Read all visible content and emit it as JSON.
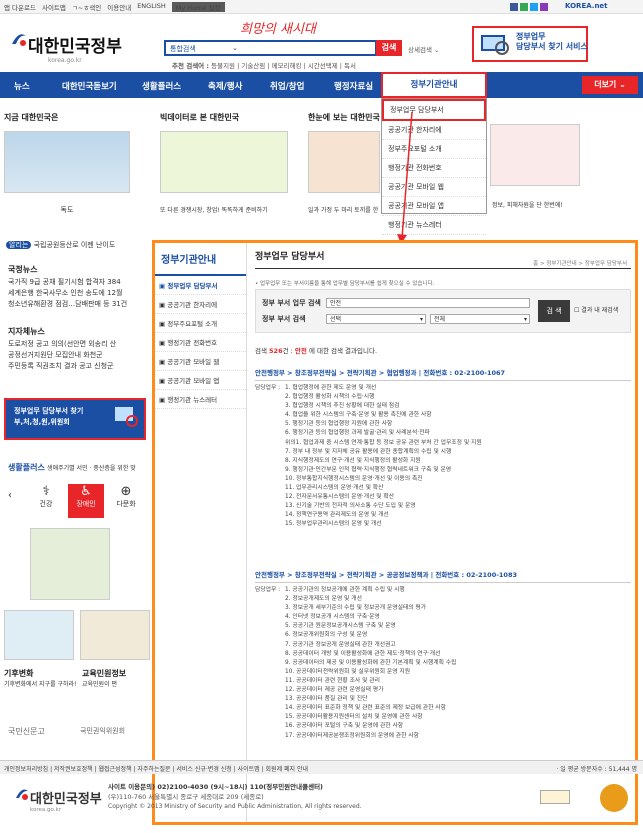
{
  "topbar": {
    "links": [
      "앱 다운로드",
      "사이트맵",
      "ㄱ~ㅎ색인",
      "이용안내",
      "ENGLISH"
    ],
    "my_home": "My Home 설정",
    "right_logo": "KOREA.net"
  },
  "header": {
    "logo_text": "대한민국정부",
    "logo_sub": "korea.go.kr",
    "search_value": "통합검색",
    "search_button": "검색",
    "detail_search": "상세검색",
    "recommended_label": "추천 검색어 :",
    "recommended": "등불지원 | 기술산림 | 메모리해킹 | 시간선택제 | 독서",
    "service_box": "정부업무\n담당부서 찾기 서비스",
    "service_l1": "정부업무",
    "service_l2": "담당부서 찾기 서비스"
  },
  "nav": {
    "items": [
      "뉴스",
      "대한민국돋보기",
      "생활플러스",
      "축제/행사",
      "취업/창업",
      "행정자료실"
    ],
    "active": "정부기관안내",
    "more": "더보기"
  },
  "dropdown": {
    "items": [
      "정부업무 담당부서",
      "공공기관 한자리에",
      "정부주요포털 소개",
      "행정기관 전화번호",
      "공공기관 모바일 웹",
      "공공기관 모바일 앱",
      "행정기관 뉴스레터"
    ]
  },
  "left": {
    "sec1_title": "지금 대한민국은",
    "sec1_caption": "독도",
    "sec2_title": "빅데이터로 본 대한민국",
    "sec2_caption": "또 다른 경쟁시장, 창업! 똑똑하게 준비하기",
    "sec3_title": "한눈에 보는 대한민국",
    "sec3_caption": "일과 가정 두 마리 토끼를 한",
    "sec4_caption": "정보, 피해자원을 단 한번에!",
    "notice_tag": "알리는",
    "notice_text": "국립공원등산로 이젠 난이도",
    "gov_news_title": "국정뉴스",
    "gov_news": [
      "국가직 9급 공채 필기시험 합격자 384",
      "세계은행 한국사무소 인천 송도에 12월",
      "청소년유해환경 점검…담배판매 등 31건"
    ],
    "local_news_title": "지자체뉴스",
    "local_news": [
      "도로저정 공고 의의(선안면 외송리 산",
      "공정선거지원단 모집안내 화천군",
      "주민등록 직권조치 결과 공고 신청군"
    ],
    "banner_text": "정부업무 담당부서 찾기\n부,처,청,원,위원회",
    "banner_l1": "정부업무 담당부서 찾기",
    "banner_l2": "부,처,청,원,위원회",
    "life_title": "생활플러스",
    "life_sub": "생애주기별 서민 · 중산층을 위한 맞",
    "life_icons": [
      "건강",
      "장애인",
      "다문화"
    ],
    "welfare_title": "기후변화",
    "welfare_text": "기후변화에서 지구를 구하라!",
    "edu_title": "교육민원정보",
    "edu_text": "교육민원이 편",
    "logos": [
      "국민신문고",
      "국민권익위원회"
    ]
  },
  "overlay": {
    "side_title": "정부기관안내",
    "side_items": [
      "정부업무 담당부서",
      "공공기관 한자리에",
      "정부주요포털 소개",
      "행정기관 전화번호",
      "공공기관 모바일 웹",
      "공공기관 모바일 앱",
      "행정기관 뉴스레터"
    ],
    "title": "정부업무 담당부서",
    "crumb": "홈 > 정부기관안내 > 정부업무 담당부서",
    "intro": "• 업무업무 또는 부서이름을 통해 업무별 담당부서를 쉽게 찾으실 수 있습니다.",
    "label_duty": "정부 부서 업무 검색",
    "duty_value": "안전",
    "label_dept": "정부 부서 검색",
    "dept_select": "선택",
    "dept_select2": "전체",
    "search_btn": "검 색",
    "in_result": "결과 내 재검색",
    "result_prefix": "검색 ",
    "result_count": "526",
    "result_mid": "건 : ",
    "result_kw": "안전",
    "result_suffix": " 에 대한 검색 결과입니다.",
    "dept1": "안전행정부 > 창조정부전략실 > 전략기획관 > 협업행정과  |  전화번호 : 02-2100-1067",
    "dept1_label": "담당업무 :",
    "duties1": [
      "1. 협업행정에 관한 제도 운영 및 개선",
      "2. 협업행정 활성화 시책의 수립·시행",
      "3. 협업행정 시책의 추진 상황에 대한 실태 점검",
      "4. 협업을 위한 시스템의 구축·운영 및 활용 촉진에 관한 사항",
      "5. 행정기관 등의 협업행정 지원에 관한 사항",
      "6. 행정기관 등의 협업행정 과제 발굴·관리 및 사례분석·전파",
      "위의1. 협업과제 중 시스템 연계·통합 등 정보 공유 관련 부처 간 업무조정 및 지원",
      "7. 정부 내 정부 및 지자체 공유 활용에 관한 종합계획의 수립 및 시행",
      "8. 지식행정제도의 연구·개선 및 지식행정의 활성화 지원",
      "9. 행정기관·민간부문 인적 협력·지식행정 협력네트워크 구축 및 운영",
      "10. 정부통합지식행정시스템의 운영·개선 및 이용의 촉진",
      "11. 업무관리시스템의 운영·개선 및 확산",
      "12. 전자문서유통시스템의 운영·개선 및 확산",
      "13. 신기술 기반의 전자적 의사소통 수단 도입 및 운영",
      "14. 정책연구용역 관리제도의 운영 및 개선",
      "15. 정부업무관리시스템의 운영 및 개선"
    ],
    "dept2": "안전행정부 > 창조정부전략실 > 전략기획관 > 공공정보정책과  |  전화번호 : 02-2100-1083",
    "dept2_label": "담당업무 :",
    "duties2": [
      "1. 공공기관의 정보공개에 관한 계획 수립 및 시행",
      "2. 정보공개제도의 운영 및 개선",
      "3. 정보공개 세부기준의 수립 및 정보공개 운영실태의 평가",
      "4. 인터넷 정보공개 시스템의 구축·운영",
      "5. 공공기관 원문정보공개시스템 구축 및 운영",
      "6. 정보공개위원회의 구성 및 운영",
      "7. 공공기관 정보공개 운영실태 관한 개선권고",
      "8. 공공데이터 개방 및 이용활성화에 관한 제도·정책의 연구·개선",
      "9. 공공데이터의 제공 및 이용활성화에 관한 기본계획 및 시행계획 수립",
      "10. 공공데이터전략위원회 및 실무위원회 운영 지원",
      "11. 공공데이터 관련 현황 조사 및 관리",
      "12. 공공데이터 제공 관련 운영실태 평가",
      "13. 공공데이터 품질 관리 및 진단",
      "14. 공공데이터 표준화 정책 및 관련 표준의 제정 보급에 관한 사항",
      "15. 공공데이터활용지원센터의 설치 및 운영에 관한 사항",
      "16. 공공데이터 포털의 구축 및 운영에 관한 사항",
      "17. 공공데이터제공분쟁조정위원회의 운영에 관한 사항"
    ]
  },
  "footer": {
    "bar": "개인정보처리방침 | 저작권보호정책 | 웹접근성정책 | 자주하는질문 | 서비스 신규·변경 신청 | 사이트맵 | 회원제 폐지 안내",
    "visitors": "· 일 평균 방문자수 : 51,444 명",
    "logo_text": "대한민국정부",
    "logo_sub": "korea.go.kr",
    "contact": "사이트 이용문의) 02)2100-4030 (9시~18시)  110(정부민원안내콜센터)",
    "address": "(우)110-760 서울특별시 종로구 세종대로 209 (세종로)",
    "copyright": "Copyright © 2013 Ministry of Security and Public Administration, All rights reserved."
  },
  "colors": {
    "brand_blue": "#1b4fa3",
    "accent_red": "#e8262a",
    "highlight_orange": "#ff8c1a"
  }
}
